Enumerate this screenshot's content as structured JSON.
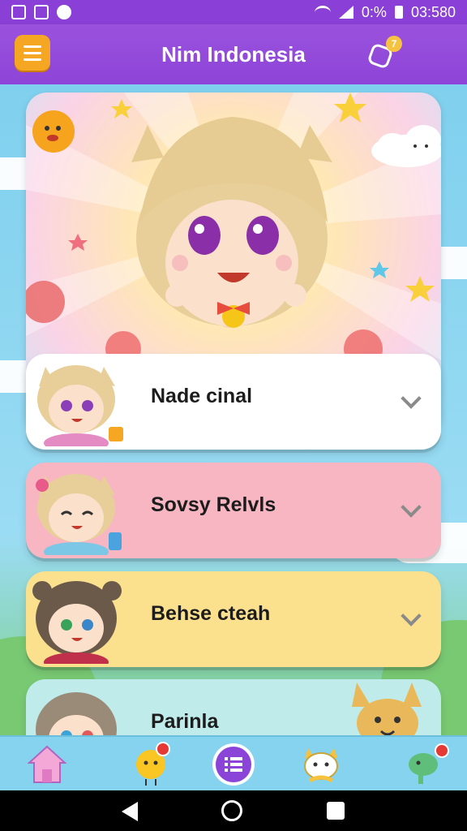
{
  "status_bar": {
    "battery": "0:%",
    "time": "03:580"
  },
  "app_bar": {
    "title": "Nim Indonesia",
    "notification_count": "7"
  },
  "cards": [
    {
      "label": "Nade cinal"
    },
    {
      "label": "Sovsy Relvls"
    },
    {
      "label": "Behse cteah"
    },
    {
      "label": "Parinla"
    }
  ],
  "bottom_nav": {
    "items": [
      "home-icon",
      "chick-icon",
      "list-icon",
      "cat-icon",
      "dino-icon"
    ]
  },
  "colors": {
    "primary": "#8d44d8",
    "accent": "#f5a623",
    "card_white": "#ffffff",
    "card_pink": "#f7b6c2",
    "card_yellow": "#fbe08d",
    "card_teal": "#bfeceb"
  }
}
